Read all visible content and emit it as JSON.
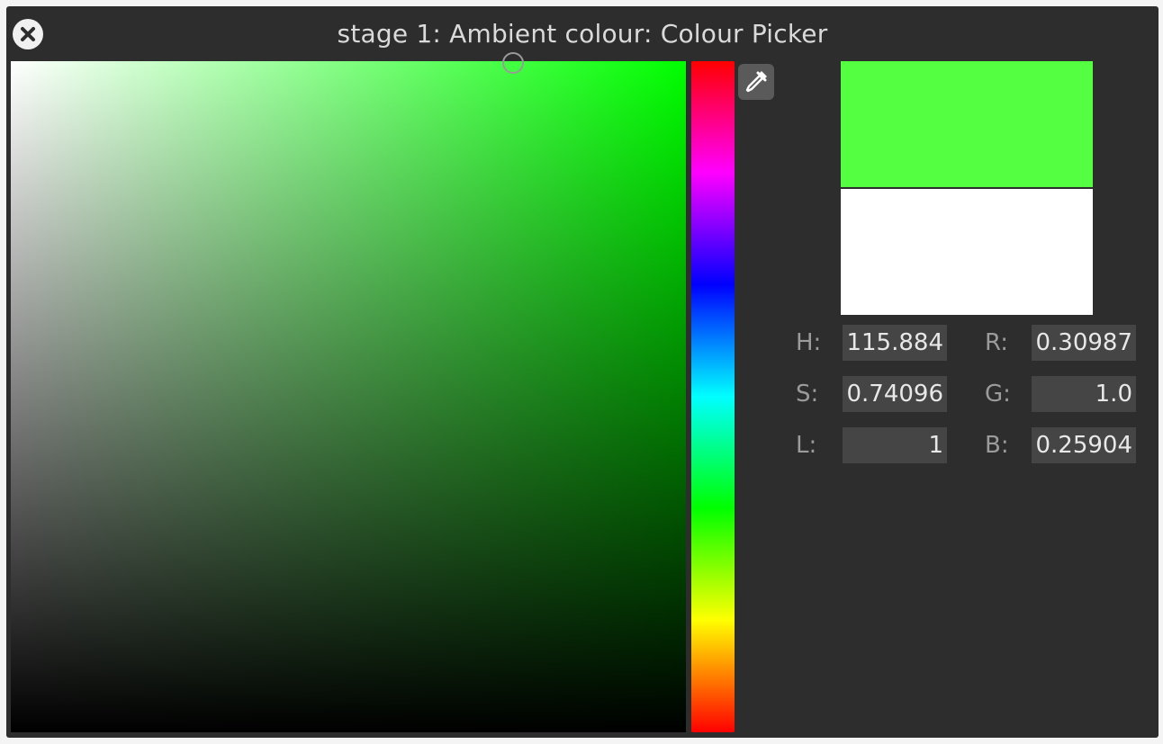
{
  "window": {
    "title": "stage 1: Ambient colour: Colour Picker"
  },
  "colors": {
    "new_colour": "#54ff42",
    "old_colour": "#ffffff",
    "hue_pure": "#00ff00"
  },
  "fields": {
    "h": {
      "label": "H:",
      "value": "115.884"
    },
    "s": {
      "label": "S:",
      "value": "0.74096"
    },
    "l": {
      "label": "L:",
      "value": "1"
    },
    "r": {
      "label": "R:",
      "value": "0.30987"
    },
    "g": {
      "label": "G:",
      "value": "1.0"
    },
    "b": {
      "label": "B:",
      "value": "0.25904"
    }
  },
  "icons": {
    "close": "close-icon",
    "eyedropper": "eyedropper-icon"
  }
}
